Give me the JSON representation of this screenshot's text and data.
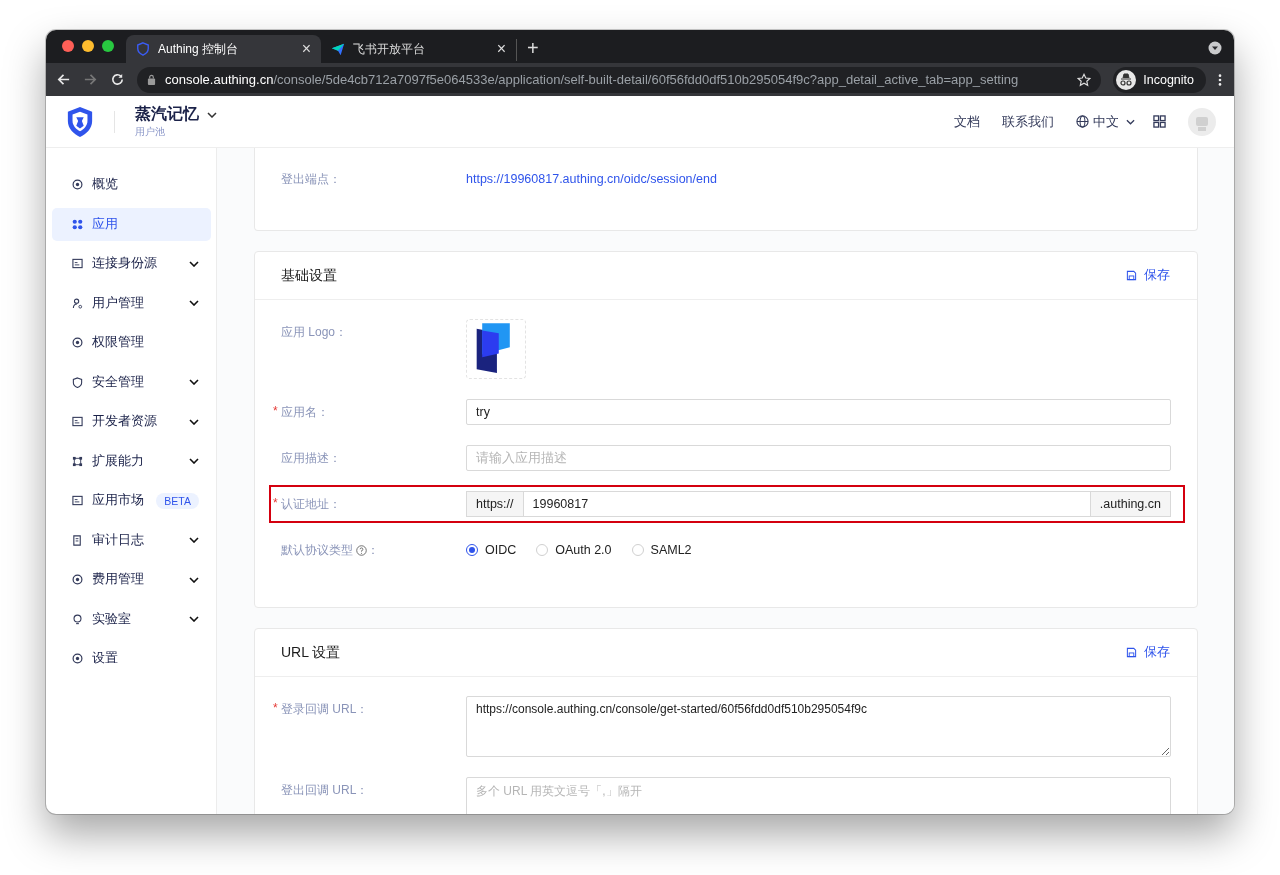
{
  "browser": {
    "tabs": [
      {
        "title": "Authing 控制台",
        "selected": true,
        "close": "×"
      },
      {
        "title": "飞书开放平台",
        "selected": false,
        "close": "×"
      }
    ],
    "new_tab": "+",
    "url_host": "console.authing.cn",
    "url_path": "/console/5de4cb712a7097f5e064533e/application/self-built-detail/60f56fdd0df510b295054f9c?app_detail_active_tab=app_setting",
    "profile": "Incognito"
  },
  "header": {
    "org_name": "蒸汽记忆",
    "org_sub": "用户池",
    "links": [
      "文档",
      "联系我们"
    ],
    "language": "中文"
  },
  "sidebar": {
    "items": [
      {
        "label": "概览",
        "selected": false,
        "expandable": false
      },
      {
        "label": "应用",
        "selected": true,
        "expandable": false
      },
      {
        "label": "连接身份源",
        "selected": false,
        "expandable": true
      },
      {
        "label": "用户管理",
        "selected": false,
        "expandable": true
      },
      {
        "label": "权限管理",
        "selected": false,
        "expandable": false
      },
      {
        "label": "安全管理",
        "selected": false,
        "expandable": true
      },
      {
        "label": "开发者资源",
        "selected": false,
        "expandable": true
      },
      {
        "label": "扩展能力",
        "selected": false,
        "expandable": true
      },
      {
        "label": "应用市场",
        "selected": false,
        "expandable": false,
        "badge": "BETA"
      },
      {
        "label": "审计日志",
        "selected": false,
        "expandable": true
      },
      {
        "label": "费用管理",
        "selected": false,
        "expandable": true
      },
      {
        "label": "实验室",
        "selected": false,
        "expandable": true
      },
      {
        "label": "设置",
        "selected": false,
        "expandable": false
      }
    ]
  },
  "cards": [
    {
      "fields": [
        {
          "kind": "link",
          "label": "登出端点：",
          "value": "https://19960817.authing.cn/oidc/session/end"
        }
      ]
    },
    {
      "title": "基础设置",
      "action": "保存",
      "fields": [
        {
          "kind": "logo",
          "label": "应用 Logo："
        },
        {
          "kind": "text",
          "label": "应用名：",
          "required_mark": "*",
          "value": "try"
        },
        {
          "kind": "text",
          "label": "应用描述：",
          "placeholder": "请输入应用描述"
        },
        {
          "kind": "addon",
          "label": "认证地址：",
          "required_mark": "*",
          "highlighted": true,
          "prefix": "https://",
          "value": "19960817",
          "suffix": ".authing.cn"
        },
        {
          "kind": "radio",
          "label": "默认协议类型",
          "help": true,
          "colon": "：",
          "options": [
            {
              "label": "OIDC",
              "selected": true
            },
            {
              "label": "OAuth 2.0",
              "selected": false
            },
            {
              "label": "SAML2",
              "selected": false
            }
          ]
        }
      ]
    },
    {
      "title": "URL 设置",
      "action": "保存",
      "fields": [
        {
          "kind": "textarea",
          "label": "登录回调 URL：",
          "required_mark": "*",
          "value": "https://console.authing.cn/console/get-started/60f56fdd0df510b295054f9c"
        },
        {
          "kind": "textarea",
          "label": "登出回调 URL：",
          "placeholder": "多个 URL 用英文逗号「,」隔开"
        }
      ]
    }
  ]
}
